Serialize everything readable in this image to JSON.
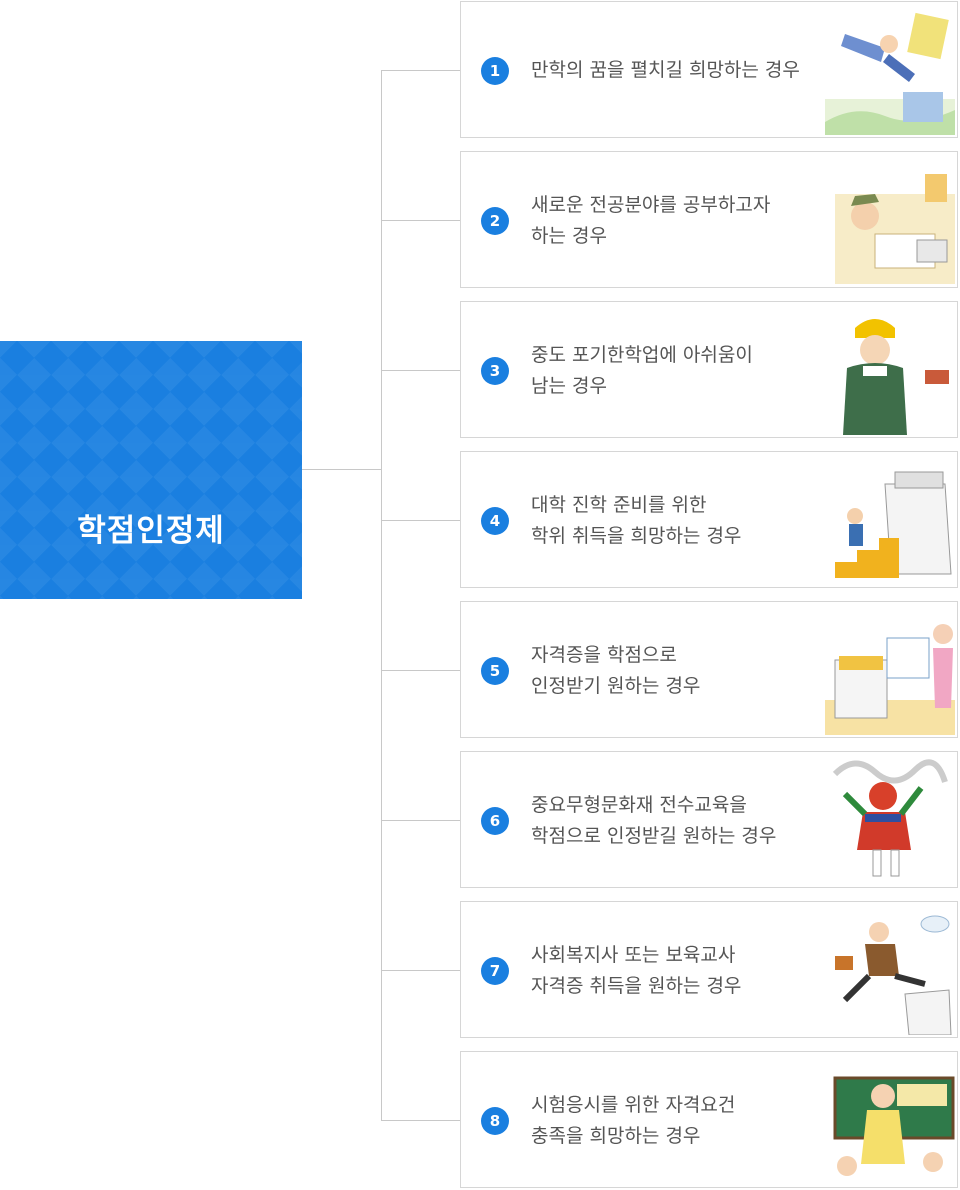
{
  "hub": {
    "title": "학점인정제",
    "icon": "graduation-cap-icon",
    "color": "#1a7fe0"
  },
  "cases": [
    {
      "number": "1",
      "lines": [
        "만학의 꿈을 펼치길 희망하는 경우"
      ],
      "illustration": "flying-student-illustration"
    },
    {
      "number": "2",
      "lines": [
        "새로운 전공분야를 공부하고자",
        "하는 경우"
      ],
      "illustration": "studying-student-illustration"
    },
    {
      "number": "3",
      "lines": [
        "중도 포기한학업에 아쉬움이",
        "남는 경우"
      ],
      "illustration": "regretful-worker-illustration"
    },
    {
      "number": "4",
      "lines": [
        "대학 진학 준비를 위한",
        "학위 취득을 희망하는 경우"
      ],
      "illustration": "stairs-university-illustration"
    },
    {
      "number": "5",
      "lines": [
        "자격증을 학점으로",
        "인정받기 원하는 경우"
      ],
      "illustration": "certificate-illustration"
    },
    {
      "number": "6",
      "lines": [
        "중요무형문화재 전수교육을",
        "학점으로 인정받길 원하는 경우"
      ],
      "illustration": "mask-dancer-illustration"
    },
    {
      "number": "7",
      "lines": [
        "사회복지사 또는 보육교사",
        "자격증 취득을 원하는 경우"
      ],
      "illustration": "jumping-man-illustration"
    },
    {
      "number": "8",
      "lines": [
        "시험응시를 위한 자격요건",
        "충족을 희망하는 경우"
      ],
      "illustration": "teacher-illustration"
    }
  ]
}
